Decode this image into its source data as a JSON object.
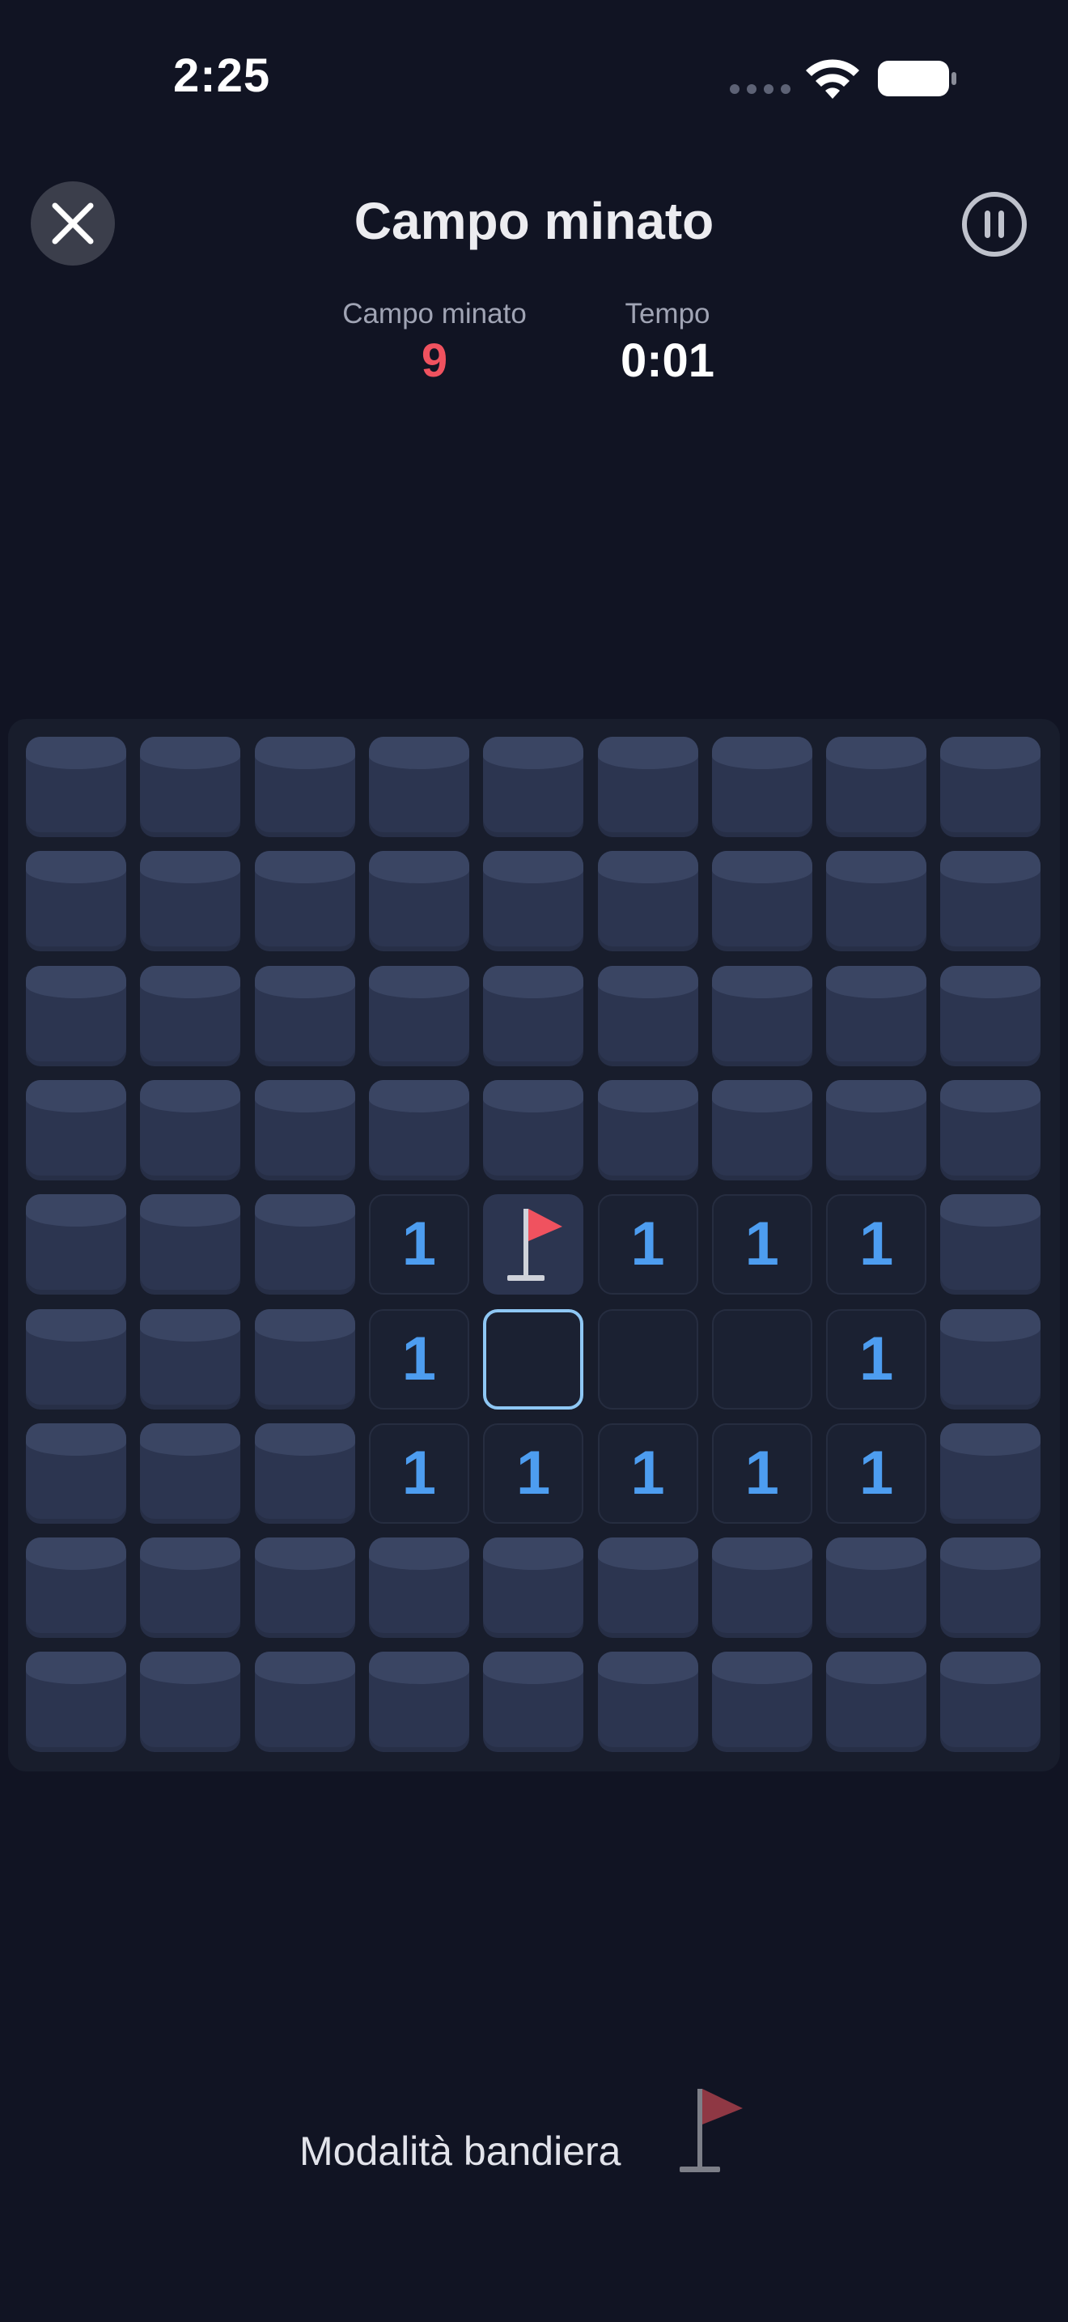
{
  "status_bar": {
    "time": "2:25"
  },
  "header": {
    "title": "Campo minato"
  },
  "stats": {
    "mines_label": "Campo minato",
    "mines_value": "9",
    "time_label": "Tempo",
    "time_value": "0:01"
  },
  "board": {
    "rows": 9,
    "cols": 9,
    "cells": [
      [
        "c",
        "c",
        "c",
        "c",
        "c",
        "c",
        "c",
        "c",
        "c"
      ],
      [
        "c",
        "c",
        "c",
        "c",
        "c",
        "c",
        "c",
        "c",
        "c"
      ],
      [
        "c",
        "c",
        "c",
        "c",
        "c",
        "c",
        "c",
        "c",
        "c"
      ],
      [
        "c",
        "c",
        "c",
        "c",
        "c",
        "c",
        "c",
        "c",
        "c"
      ],
      [
        "c",
        "c",
        "c",
        "1",
        "F",
        "1",
        "1",
        "1",
        "c"
      ],
      [
        "c",
        "c",
        "c",
        "1",
        "S",
        "0",
        "0",
        "1",
        "c"
      ],
      [
        "c",
        "c",
        "c",
        "1",
        "1",
        "1",
        "1",
        "1",
        "c"
      ],
      [
        "c",
        "c",
        "c",
        "c",
        "c",
        "c",
        "c",
        "c",
        "c"
      ],
      [
        "c",
        "c",
        "c",
        "c",
        "c",
        "c",
        "c",
        "c",
        "c"
      ]
    ]
  },
  "footer": {
    "flag_mode_label": "Modalità bandiera"
  },
  "colors": {
    "background": "#111423",
    "covered_cell": "#2c3550",
    "number": "#4d9df0",
    "flag": "#f0525f",
    "mines_count": "#f0525f",
    "selected_border": "#8ec7f4"
  }
}
